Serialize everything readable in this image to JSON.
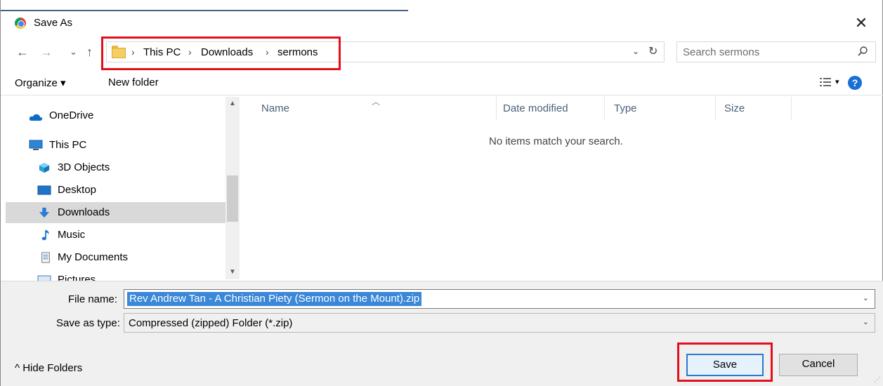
{
  "window": {
    "title": "Save As",
    "close_glyph": "✕"
  },
  "nav": {
    "back_glyph": "←",
    "forward_glyph": "→",
    "recent_glyph": "⌄",
    "up_glyph": "↑",
    "breadcrumb": [
      "This PC",
      "Downloads",
      "sermons"
    ],
    "separator": "›",
    "dropdown_glyph": "⌄",
    "refresh_glyph": "↻",
    "search_placeholder": "Search sermons"
  },
  "toolbar": {
    "organize_label": "Organize ▾",
    "new_folder_label": "New folder",
    "views_dropdown_glyph": "▾",
    "help_glyph": "?"
  },
  "sidebar": {
    "items": [
      {
        "label": "OneDrive",
        "icon": "onedrive-icon"
      },
      {
        "label": "This PC",
        "icon": "computer-icon"
      },
      {
        "label": "3D Objects",
        "icon": "cube-icon"
      },
      {
        "label": "Desktop",
        "icon": "desktop-icon"
      },
      {
        "label": "Downloads",
        "icon": "download-arrow-icon",
        "selected": true
      },
      {
        "label": "Music",
        "icon": "music-note-icon"
      },
      {
        "label": "My Documents",
        "icon": "document-icon"
      },
      {
        "label": "Pictures",
        "icon": "pictures-icon"
      }
    ],
    "scroll_up_glyph": "▲",
    "scroll_down_glyph": "▼"
  },
  "filelist": {
    "columns": [
      "Name",
      "Date modified",
      "Type",
      "Size"
    ],
    "sort_glyph": "︿",
    "empty_message": "No items match your search."
  },
  "form": {
    "file_name_label": "File name:",
    "file_name_value": "Rev Andrew Tan - A Christian Piety (Sermon on the Mount).zip",
    "save_as_type_label": "Save as type:",
    "save_as_type_value": "Compressed (zipped) Folder (*.zip)",
    "dropdown_glyph": "⌄",
    "hide_folders_label": "^ Hide Folders",
    "save_label": "Save",
    "cancel_label": "Cancel"
  },
  "colors": {
    "highlight_red": "#e2101b",
    "selection_blue": "#3b87d8",
    "primary_border": "#2a79d2"
  }
}
